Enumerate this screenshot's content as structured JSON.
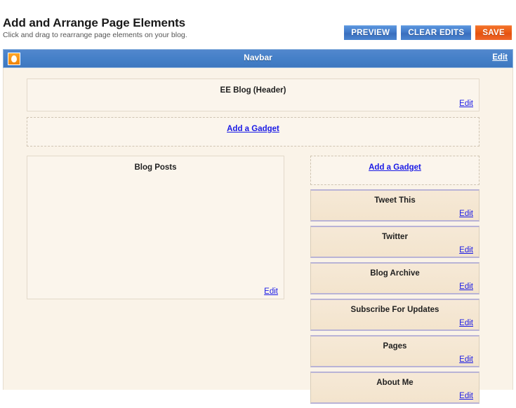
{
  "header": {
    "title": "Add and Arrange Page Elements",
    "subtitle": "Click and drag to rearrange page elements on your blog.",
    "buttons": [
      {
        "label": "PREVIEW",
        "name": "preview-button",
        "style": "blue"
      },
      {
        "label": "CLEAR EDITS",
        "name": "clear-edits-button",
        "style": "blue"
      },
      {
        "label": "SAVE",
        "name": "save-button",
        "style": "orange"
      }
    ]
  },
  "navbar": {
    "title": "Navbar",
    "edit_label": "Edit",
    "icon": "blogger-logo-icon",
    "background_color": "#4580c8"
  },
  "layout": {
    "header_section": {
      "title": "EE Blog (Header)",
      "edit_label": "Edit"
    },
    "top_add_gadget": {
      "label": "Add a Gadget"
    },
    "blog_posts": {
      "title": "Blog Posts",
      "edit_label": "Edit"
    },
    "sidebar": {
      "add_gadget_label": "Add a Gadget",
      "gadgets": [
        {
          "title": "Tweet This",
          "edit_label": "Edit"
        },
        {
          "title": "Twitter",
          "edit_label": "Edit"
        },
        {
          "title": "Blog Archive",
          "edit_label": "Edit"
        },
        {
          "title": "Subscribe For Updates",
          "edit_label": "Edit"
        },
        {
          "title": "Pages",
          "edit_label": "Edit"
        },
        {
          "title": "About Me",
          "edit_label": "Edit"
        }
      ]
    }
  },
  "colors": {
    "canvas": "#faf3e8",
    "gadget": "#f3e4cd",
    "link": "#1a1ae6",
    "accent_blue": "#4580c8",
    "accent_orange": "#ea5a12"
  }
}
